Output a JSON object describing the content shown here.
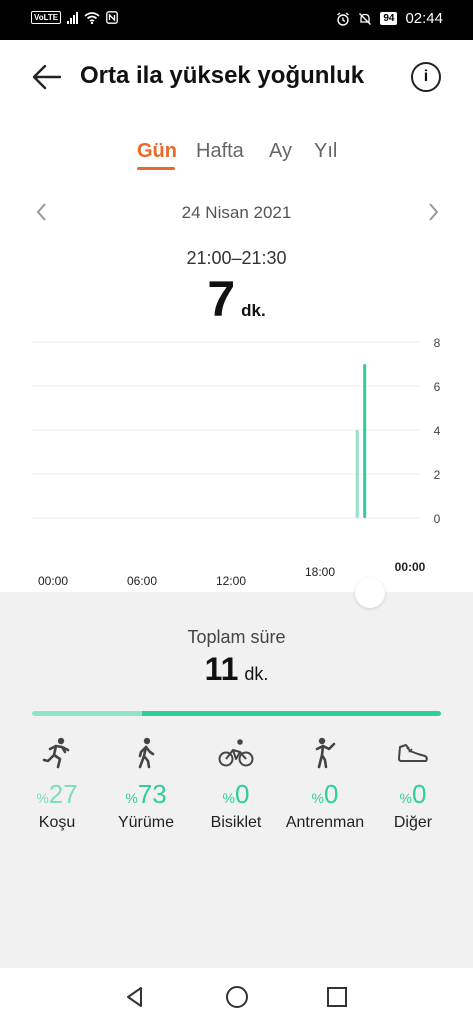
{
  "status": {
    "volte": "VoLTE",
    "battery": "94",
    "time": "02:44"
  },
  "header": {
    "title": "Orta ila yüksek yoğunluk",
    "info_label": "i"
  },
  "tabs": [
    {
      "label": "Gün",
      "active": true
    },
    {
      "label": "Hafta",
      "active": false
    },
    {
      "label": "Ay",
      "active": false
    },
    {
      "label": "Yıl",
      "active": false
    }
  ],
  "date": "24 Nisan 2021",
  "selected": {
    "range": "21:00–21:30",
    "value": "7",
    "unit": "dk."
  },
  "chart_data": {
    "type": "bar",
    "x_ticks": [
      "00:00",
      "06:00",
      "12:00",
      "18:00",
      "00:00"
    ],
    "y_ticks": [
      "8",
      "6",
      "4",
      "2",
      "0"
    ],
    "ylim": [
      0,
      8
    ],
    "bars": [
      {
        "time": "20:30",
        "value": 4,
        "color": "#8fe3c9"
      },
      {
        "time": "21:00",
        "value": 7,
        "color": "#2ecf98"
      }
    ]
  },
  "total": {
    "label": "Toplam süre",
    "value": "11",
    "unit": "dk."
  },
  "progress": {
    "koshu_fraction": 0.27
  },
  "activities": [
    {
      "name": "Koşu",
      "percent_symbol": "%",
      "value": "27",
      "icon": "running-icon"
    },
    {
      "name": "Yürüme",
      "percent_symbol": "%",
      "value": "73",
      "icon": "walking-icon"
    },
    {
      "name": "Bisiklet",
      "percent_symbol": "%",
      "value": "0",
      "icon": "bicycle-icon"
    },
    {
      "name": "Antrenman",
      "percent_symbol": "%",
      "value": "0",
      "icon": "workout-icon"
    },
    {
      "name": "Diğer",
      "percent_symbol": "%",
      "value": "0",
      "icon": "shoe-icon"
    }
  ],
  "colors": {
    "accent": "#e8692a",
    "green": "#2ecf98",
    "light_green": "#8fe3c9"
  }
}
